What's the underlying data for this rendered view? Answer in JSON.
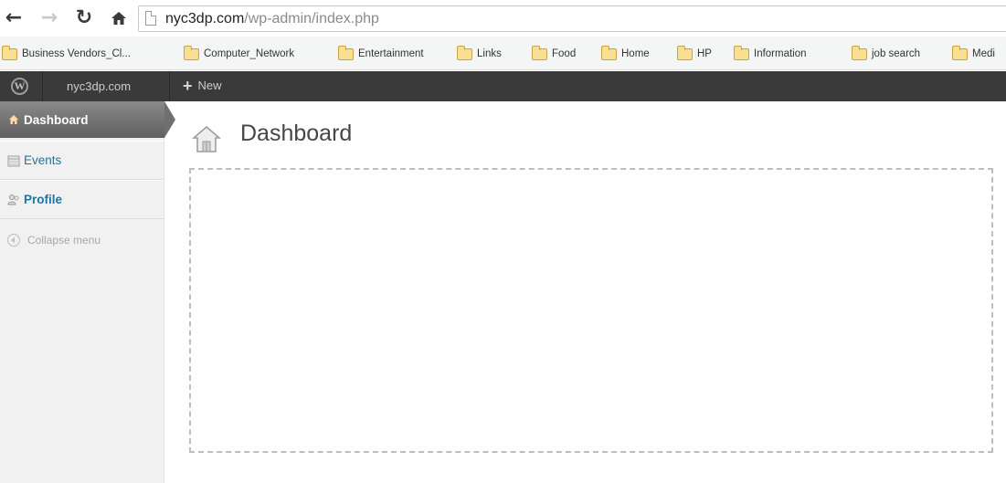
{
  "browser": {
    "url_host": "nyc3dp.com",
    "url_path": "/wp-admin/index.php",
    "bookmarks": [
      "Business Vendors_Cl...",
      "Computer_Network",
      "Entertainment",
      "Links",
      "Food",
      "Home",
      "HP",
      "Information",
      "job search",
      "Medi"
    ]
  },
  "adminbar": {
    "site_name": "nyc3dp.com",
    "new_label": "New"
  },
  "sidebar": {
    "items": [
      {
        "label": "Dashboard",
        "icon": "home-icon",
        "current": true
      },
      {
        "label": "Events",
        "icon": "calendar-icon"
      },
      {
        "label": "Profile",
        "icon": "users-icon"
      }
    ],
    "collapse_label": "Collapse menu"
  },
  "main": {
    "title": "Dashboard",
    "title_icon": "home-icon"
  },
  "colors": {
    "adminbar_bg": "#3a3a3a",
    "link": "#21759b",
    "sidebar_bg": "#f1f1f1"
  }
}
